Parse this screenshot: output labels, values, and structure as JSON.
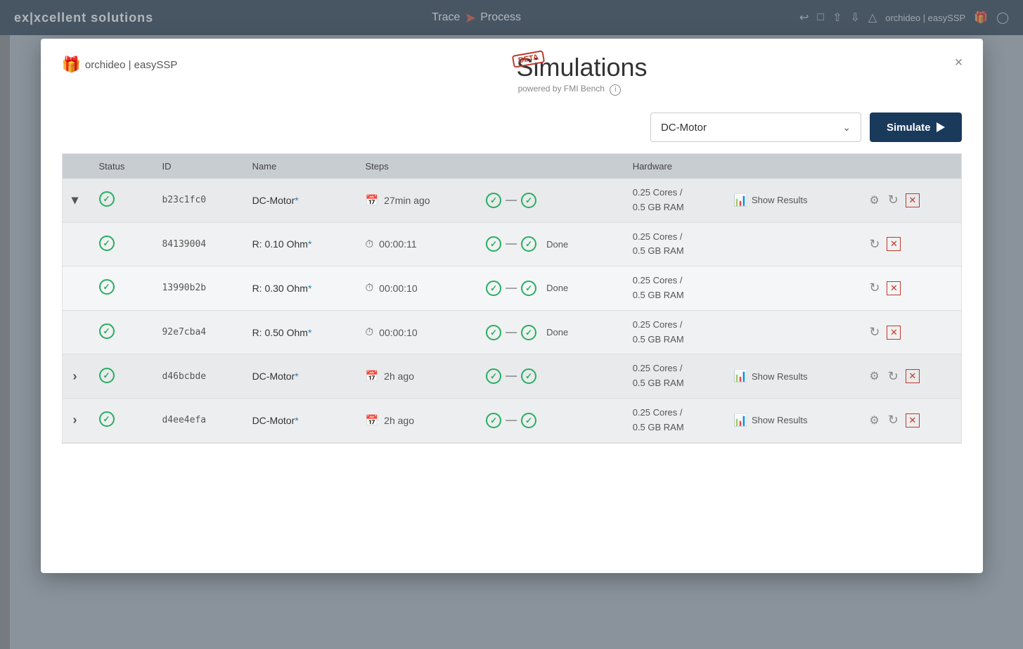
{
  "topbar": {
    "logo": "ex|xcellent solutions",
    "trace_label": "Trace",
    "process_label": "Process",
    "user_label": "orchideo | easySSP"
  },
  "modal": {
    "logo_text": "orchideo | easySSP",
    "beta_label": "BETA",
    "title": "Simulations",
    "powered_by": "powered by FMI Bench",
    "close_icon": "×",
    "dropdown_value": "DC-Motor",
    "simulate_button": "Simulate",
    "table": {
      "headers": [
        "Status",
        "ID",
        "Name",
        "Steps",
        "Hardware",
        "",
        ""
      ],
      "rows": [
        {
          "type": "parent",
          "expand": "▾",
          "status": "check",
          "id": "b23c1fc0",
          "name": "DC-Motor*",
          "time_type": "calendar",
          "time_value": "27min ago",
          "step_status_left": "check",
          "step_status_right": "check",
          "done_label": "",
          "hardware_line1": "0.25 Cores /",
          "hardware_line2": "0.5 GB RAM",
          "show_results": "Show Results",
          "has_gear": true,
          "has_refresh": true,
          "has_delete": true
        },
        {
          "type": "child",
          "expand": "",
          "status": "check",
          "id": "84139004",
          "name": "R: 0.10 Ohm*",
          "time_type": "clock",
          "time_value": "00:00:11",
          "step_status_left": "check",
          "step_status_right": "check",
          "done_label": "Done",
          "hardware_line1": "0.25 Cores /",
          "hardware_line2": "0.5 GB RAM",
          "show_results": "",
          "has_gear": false,
          "has_refresh": true,
          "has_delete": true
        },
        {
          "type": "child",
          "expand": "",
          "status": "check",
          "id": "13990b2b",
          "name": "R: 0.30 Ohm*",
          "time_type": "clock",
          "time_value": "00:00:10",
          "step_status_left": "check",
          "step_status_right": "check",
          "done_label": "Done",
          "hardware_line1": "0.25 Cores /",
          "hardware_line2": "0.5 GB RAM",
          "show_results": "",
          "has_gear": false,
          "has_refresh": true,
          "has_delete": true
        },
        {
          "type": "child",
          "expand": "",
          "status": "check",
          "id": "92e7cba4",
          "name": "R: 0.50 Ohm*",
          "time_type": "clock",
          "time_value": "00:00:10",
          "step_status_left": "check",
          "step_status_right": "check",
          "done_label": "Done",
          "hardware_line1": "0.25 Cores /",
          "hardware_line2": "0.5 GB RAM",
          "show_results": "",
          "has_gear": false,
          "has_refresh": true,
          "has_delete": true
        },
        {
          "type": "parent",
          "expand": "›",
          "status": "check",
          "id": "d46bcbde",
          "name": "DC-Motor*",
          "time_type": "calendar",
          "time_value": "2h ago",
          "step_status_left": "check",
          "step_status_right": "check",
          "done_label": "",
          "hardware_line1": "0.25 Cores /",
          "hardware_line2": "0.5 GB RAM",
          "show_results": "Show Results",
          "has_gear": true,
          "has_refresh": true,
          "has_delete": true
        },
        {
          "type": "parent",
          "expand": "›",
          "status": "check",
          "id": "d4ee4efa",
          "name": "DC-Motor*",
          "time_type": "calendar",
          "time_value": "2h ago",
          "step_status_left": "check",
          "step_status_right": "check",
          "done_label": "",
          "hardware_line1": "0.25 Cores /",
          "hardware_line2": "0.5 GB RAM",
          "show_results": "Show Results",
          "has_gear": true,
          "has_refresh": true,
          "has_delete": true
        }
      ]
    }
  }
}
